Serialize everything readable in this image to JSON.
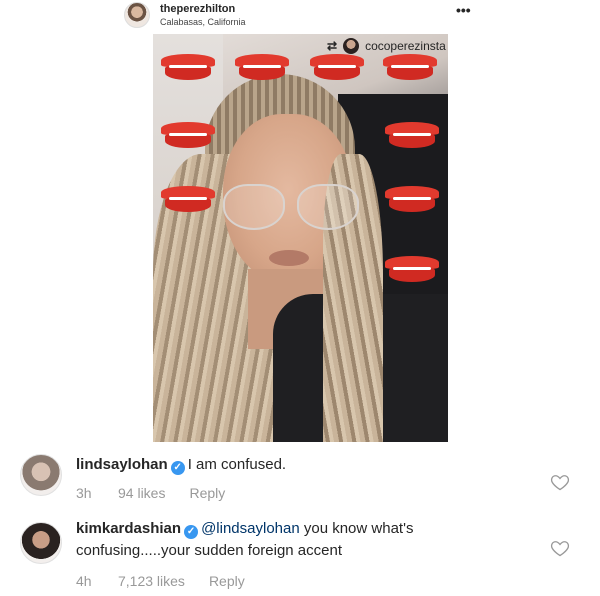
{
  "post": {
    "username": "theperezhilton",
    "location": "Calabasas, California",
    "more_icon": "•••",
    "repost_icon": "repost-icon",
    "repost_username": "cocoperezinsta"
  },
  "comments": [
    {
      "username": "lindsaylohan",
      "text": "I am confused.",
      "time": "3h",
      "likes": "94 likes",
      "reply": "Reply"
    },
    {
      "username": "kimkardashian",
      "mention": "@lindsaylohan",
      "text_line1": " you know what's",
      "text_line2": "confusing.....your sudden foreign accent",
      "time": "4h",
      "likes": "7,123 likes",
      "reply": "Reply"
    }
  ],
  "colors": {
    "lip_red": "#e23a2e",
    "verified_blue": "#3897f0",
    "meta_gray": "#999999"
  }
}
